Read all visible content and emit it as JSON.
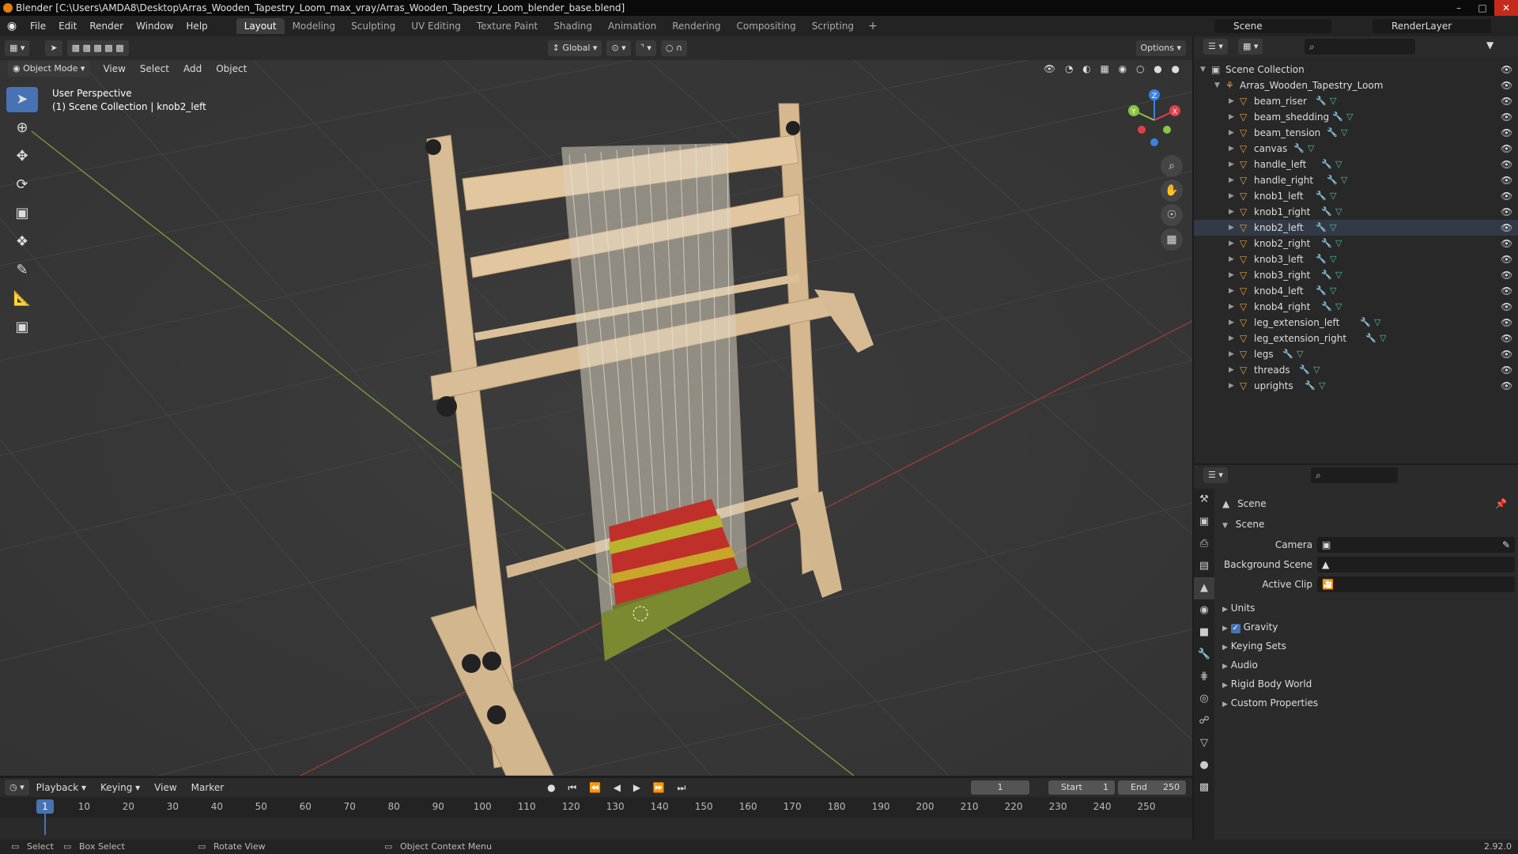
{
  "window": {
    "title": "Blender [C:\\Users\\AMDA8\\Desktop\\Arras_Wooden_Tapestry_Loom_max_vray/Arras_Wooden_Tapestry_Loom_blender_base.blend]"
  },
  "menu": [
    "File",
    "Edit",
    "Render",
    "Window",
    "Help"
  ],
  "workspaces": [
    "Layout",
    "Modeling",
    "Sculpting",
    "UV Editing",
    "Texture Paint",
    "Shading",
    "Animation",
    "Rendering",
    "Compositing",
    "Scripting"
  ],
  "active_workspace": "Layout",
  "scene_name": "Scene",
  "render_layer": "RenderLayer",
  "viewport_header": {
    "mode": "Object Mode",
    "menus": [
      "View",
      "Select",
      "Add",
      "Object"
    ],
    "orientation": "Global",
    "options": "Options"
  },
  "viewport_info": {
    "line1": "User Perspective",
    "line2": "(1) Scene Collection | knob2_left"
  },
  "gizmo": {
    "x": "X",
    "y": "Y",
    "z": "Z"
  },
  "outliner": {
    "root": "Scene Collection",
    "collection": "Arras_Wooden_Tapestry_Loom",
    "items": [
      "beam_riser",
      "beam_shedding",
      "beam_tension",
      "canvas",
      "handle_left",
      "handle_right",
      "knob1_left",
      "knob1_right",
      "knob2_left",
      "knob2_right",
      "knob3_left",
      "knob3_right",
      "knob4_left",
      "knob4_right",
      "leg_extension_left",
      "leg_extension_right",
      "legs",
      "threads",
      "uprights"
    ],
    "selected": "knob2_left"
  },
  "properties": {
    "title": "Scene",
    "section": "Scene",
    "camera_label": "Camera",
    "background_label": "Background Scene",
    "clip_label": "Active Clip",
    "panels": [
      "Units",
      "Gravity",
      "Keying Sets",
      "Audio",
      "Rigid Body World",
      "Custom Properties"
    ],
    "gravity_checked": true
  },
  "timeline": {
    "menus": [
      "Playback",
      "Keying",
      "View",
      "Marker"
    ],
    "current_frame": "1",
    "start_label": "Start",
    "start": "1",
    "end_label": "End",
    "end": "250",
    "ticks": [
      "1",
      "10",
      "20",
      "30",
      "40",
      "50",
      "60",
      "70",
      "80",
      "90",
      "100",
      "110",
      "120",
      "130",
      "140",
      "150",
      "160",
      "170",
      "180",
      "190",
      "200",
      "210",
      "220",
      "230",
      "240",
      "250"
    ]
  },
  "statusbar": {
    "select": "Select",
    "box_select": "Box Select",
    "rotate": "Rotate View",
    "context": "Object Context Menu",
    "version": "2.92.0"
  },
  "colors": {
    "accent": "#4772b3",
    "object_icon": "#e8a03a",
    "axis_x": "#e0404a",
    "axis_y": "#8ac540",
    "axis_z": "#3a82e0"
  }
}
